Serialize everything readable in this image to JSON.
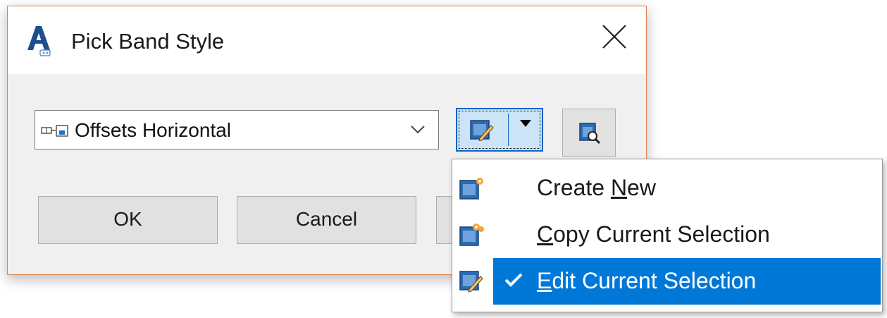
{
  "window": {
    "title": "Pick Band Style",
    "app_icon": "autocad-civil-a-icon",
    "close_icon": "close-x-icon"
  },
  "style_selector": {
    "value": "Offsets Horizontal",
    "item_icon": "band-style-icon",
    "dropdown_icon": "chevron-down-icon"
  },
  "toolbar": {
    "edit_icon": "edit-style-icon",
    "edit_dropdown_icon": "triangle-down-icon",
    "pick_icon": "pick-from-drawing-icon"
  },
  "buttons": {
    "ok": "OK",
    "cancel": "Cancel"
  },
  "menu": {
    "items": [
      {
        "pre": "Create ",
        "mnemonic": "N",
        "post": "ew",
        "icon": "create-new-style-icon",
        "selected": false
      },
      {
        "pre": "",
        "mnemonic": "C",
        "post": "opy Current Selection",
        "icon": "copy-style-icon",
        "selected": false
      },
      {
        "pre": "",
        "mnemonic": "E",
        "post": "dit Current Selection",
        "icon": "edit-style-icon",
        "selected": true,
        "checked": true
      }
    ]
  },
  "colors": {
    "accent": "#0078d7",
    "dialog_border": "#d9834f",
    "dialog_bg": "#f0f0f0"
  }
}
